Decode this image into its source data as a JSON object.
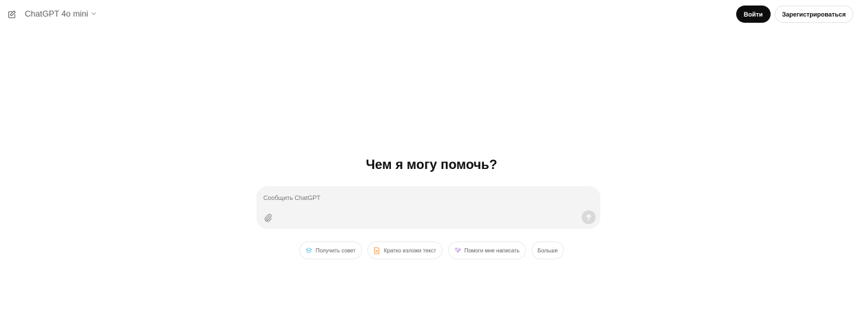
{
  "header": {
    "model_name": "ChatGPT 4o mini",
    "login_label": "Войти",
    "signup_label": "Зарегистрироваться"
  },
  "main": {
    "heading": "Чем я могу помочь?",
    "composer": {
      "placeholder": "Сообщить ChatGPT",
      "value": ""
    },
    "suggestions": [
      {
        "label": "Получить совет",
        "icon": "graduation-cap-icon",
        "color": "#7ad0e8"
      },
      {
        "label": "Кратко изложи текст",
        "icon": "document-icon",
        "color": "#f0a35e"
      },
      {
        "label": "Помоги мне написать",
        "icon": "pen-icon",
        "color": "#c28ee0"
      },
      {
        "label": "Больше",
        "icon": "",
        "color": ""
      }
    ]
  },
  "colors": {
    "primary_button": "#0d0d0d",
    "composer_bg": "#f4f4f4",
    "send_button": "#d9d9d9"
  }
}
